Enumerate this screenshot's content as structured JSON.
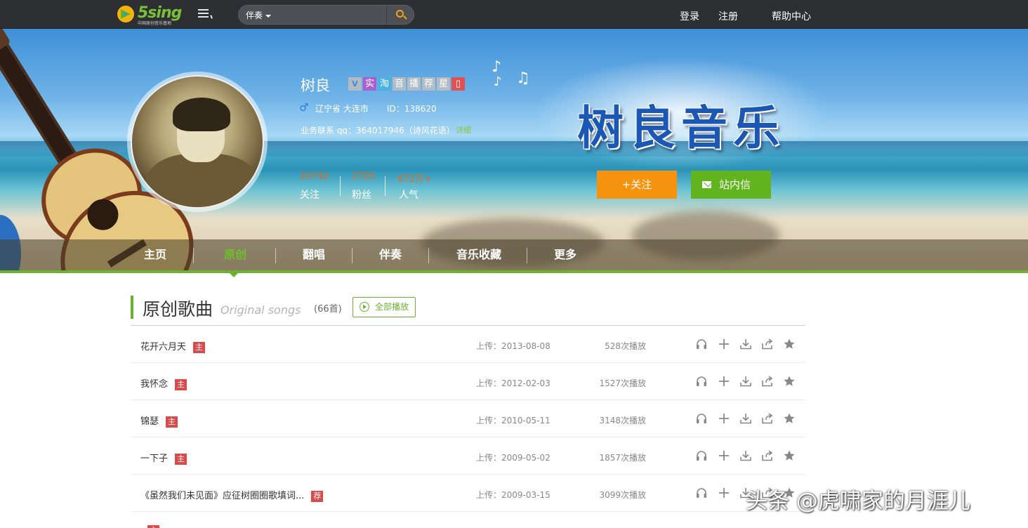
{
  "topbar": {
    "logo_text": "5sing",
    "logo_sub": "中国原创音乐基地",
    "search_category": "伴奏",
    "search_placeholder": "",
    "login": "登录",
    "register": "注册",
    "help": "帮助中心"
  },
  "profile": {
    "name": "树良",
    "badges": [
      "V",
      "实",
      "淘",
      "音",
      "播",
      "荐",
      "星",
      "▯"
    ],
    "gender_symbol": "♂",
    "location": "辽宁省 大连市",
    "id_label": "ID：138620",
    "contact": "业务联系 qq：364017946（诗风花语）",
    "contact_more": "详细",
    "stats": [
      {
        "value": "20742",
        "label": "关注"
      },
      {
        "value": "2705",
        "label": "粉丝"
      },
      {
        "value": "672万+",
        "label": "人气"
      }
    ],
    "banner_title": "树良音乐",
    "follow_button": "+关注",
    "message_button": "站内信"
  },
  "nav": {
    "items": [
      "主页",
      "原创",
      "翻唱",
      "伴奏",
      "音乐收藏",
      "更多"
    ],
    "active": "原创"
  },
  "section": {
    "title": "原创歌曲",
    "subtitle": "Original songs",
    "count": "(66首)",
    "play_all": "全部播放"
  },
  "songs": [
    {
      "title": "花开六月天",
      "tag": "主",
      "date": "上传：2013-08-08",
      "plays": "528次播放"
    },
    {
      "title": "我怀念",
      "tag": "主",
      "date": "上传：2012-02-03",
      "plays": "1527次播放"
    },
    {
      "title": "锦瑟",
      "tag": "主",
      "date": "上传：2010-05-11",
      "plays": "3148次播放"
    },
    {
      "title": "一下子",
      "tag": "主",
      "date": "上传：2009-05-02",
      "plays": "1857次播放"
    },
    {
      "title": "《虽然我们未见面》应征树圈圈歌填词...",
      "tag": "荐",
      "date": "上传：2009-03-15",
      "plays": "3099次播放"
    },
    {
      "title": "",
      "tag": "主",
      "date": "",
      "plays": ""
    }
  ],
  "action_icons": [
    "headphones-icon",
    "add-icon",
    "download-icon",
    "share-icon",
    "star-icon"
  ],
  "watermark": "头条 @虎啸家的月涯儿",
  "colors": {
    "accent_green": "#6bb32e",
    "follow_orange": "#f5920e",
    "tag_red": "#d94a4a",
    "topbar": "#2e2f33"
  }
}
